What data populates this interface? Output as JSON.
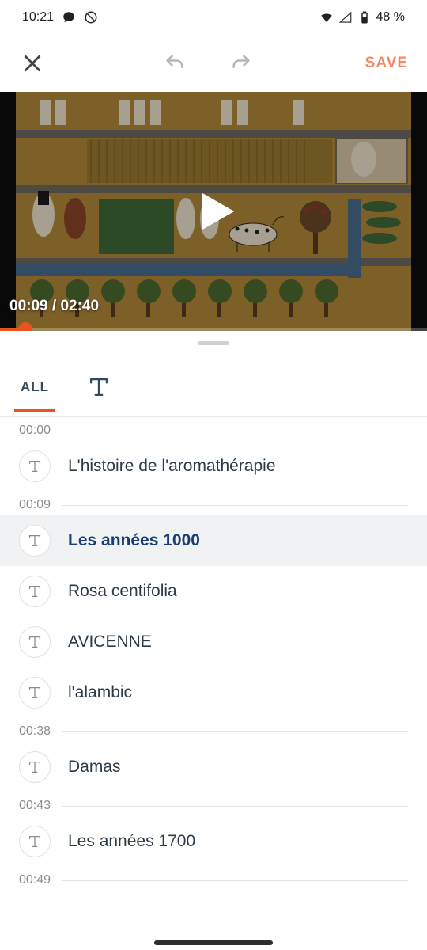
{
  "status": {
    "time": "10:21",
    "battery": "48 %"
  },
  "toolbar": {
    "save_label": "SAVE"
  },
  "video": {
    "current_time": "00:09",
    "duration": "02:40",
    "separator": " / "
  },
  "tabs": {
    "all_label": "ALL"
  },
  "timeline": {
    "markers": [
      "00:00",
      "00:09",
      "00:38",
      "00:43",
      "00:49"
    ],
    "items": [
      {
        "title": "L'histoire de l'aromathérapie"
      },
      {
        "title": "Les années 1000"
      },
      {
        "title": "Rosa centifolia"
      },
      {
        "title": "AVICENNE"
      },
      {
        "title": "l'alambic"
      },
      {
        "title": "Damas"
      },
      {
        "title": "Les années 1700"
      }
    ]
  }
}
